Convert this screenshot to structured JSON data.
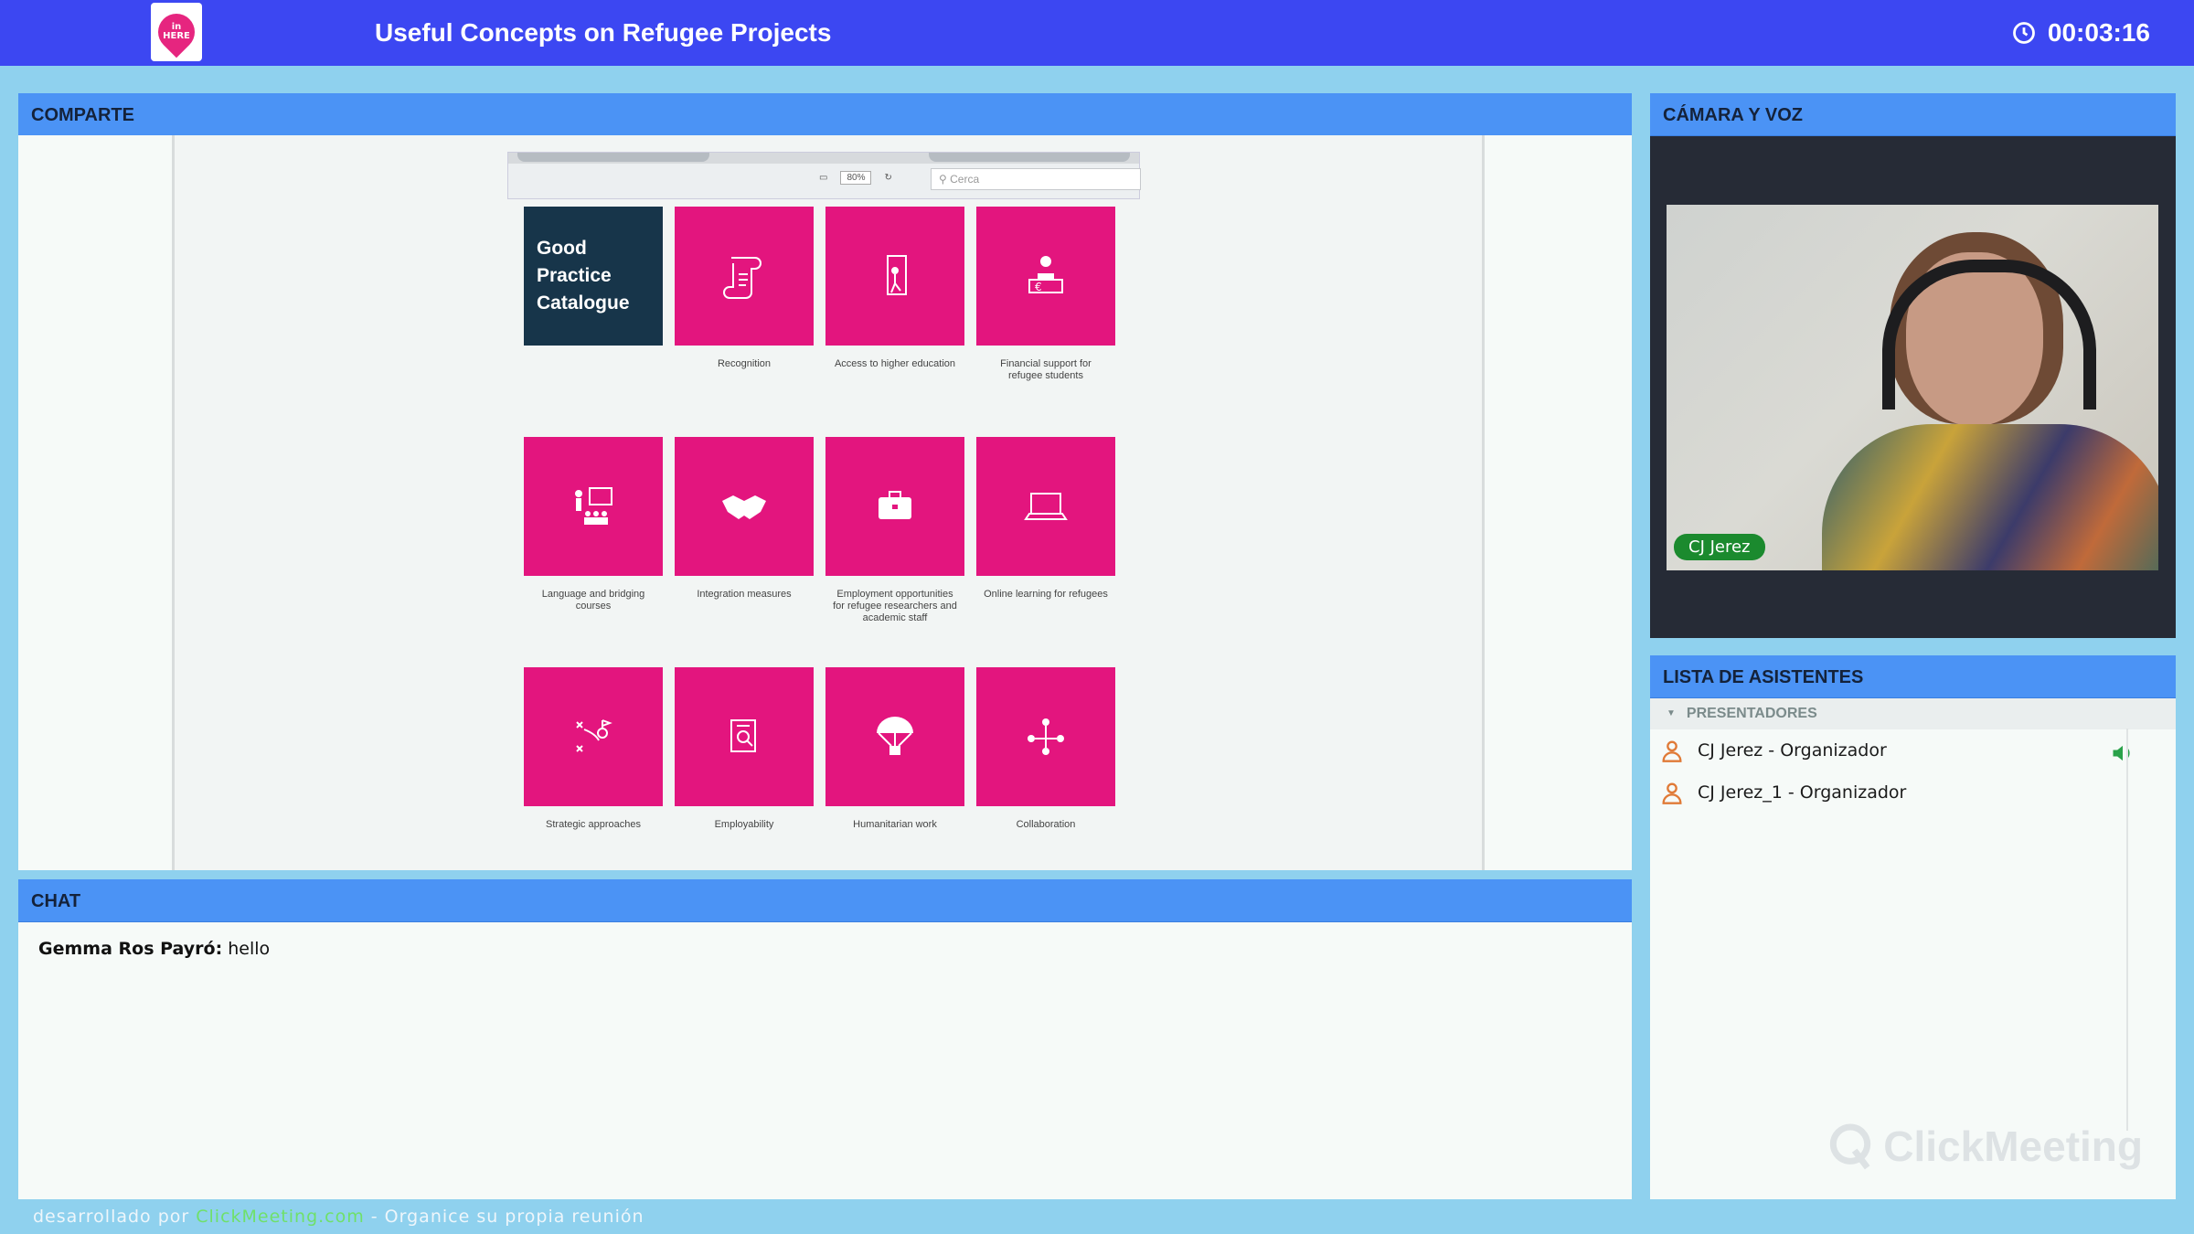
{
  "header": {
    "logo_text": "in HERE",
    "title": "Useful Concepts on Refugee Projects",
    "timer": "00:03:16",
    "accent_color": "#3c47f2"
  },
  "share": {
    "title": "COMPARTE",
    "browser": {
      "zoom": "80%",
      "search_placeholder": "Cerca"
    },
    "catalog_title": "Good Practice Catalogue",
    "tiles": [
      {
        "label": "Recognition",
        "icon": "scroll-icon"
      },
      {
        "label": "Access to higher education",
        "icon": "door-walk-icon"
      },
      {
        "label": "Financial support for refugee students",
        "icon": "euro-support-icon"
      },
      {
        "label": "Language and bridging courses",
        "icon": "classroom-icon"
      },
      {
        "label": "Integration measures",
        "icon": "handshake-icon"
      },
      {
        "label": "Employment opportunities for refugee researchers and academic staff",
        "icon": "briefcase-icon"
      },
      {
        "label": "Online learning for refugees",
        "icon": "laptop-icon"
      },
      {
        "label": "Strategic approaches",
        "icon": "strategy-icon"
      },
      {
        "label": "Employability",
        "icon": "cv-search-icon"
      },
      {
        "label": "Humanitarian work",
        "icon": "parachute-icon"
      },
      {
        "label": "Collaboration",
        "icon": "network-icon"
      }
    ],
    "tile_color": "#e3157e",
    "catalog_color": "#17354a"
  },
  "camera": {
    "title": "CÁMARA Y VOZ",
    "participant_name": "CJ Jerez"
  },
  "attendees": {
    "title": "LISTA DE ASISTENTES",
    "section": "PRESENTADORES",
    "list": [
      {
        "name": "CJ Jerez  -  Organizador",
        "speaking": true
      },
      {
        "name": "CJ Jerez_1  -  Organizador",
        "speaking": false
      }
    ],
    "watermark": "ClickMeeting"
  },
  "chat": {
    "title": "CHAT",
    "messages": [
      {
        "author": "Gemma Ros Payró:",
        "text": "hello"
      }
    ]
  },
  "footer": {
    "prefix": "desarrollado por ",
    "link": "ClickMeeting.com",
    "suffix": " - Organice su propia reunión"
  }
}
